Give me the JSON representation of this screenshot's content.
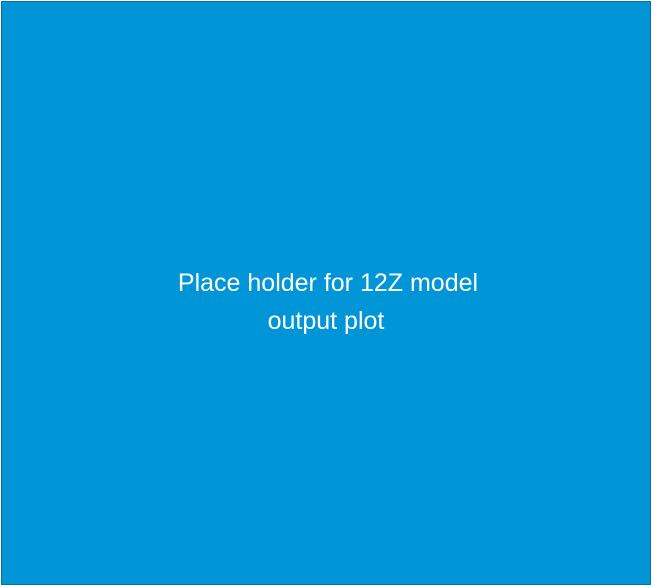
{
  "placeholder": {
    "line1": "Place holder for 12Z model",
    "line2": "output plot"
  },
  "colors": {
    "background": "#0095d7",
    "border": "#0a6f9f",
    "text": "#ffffff"
  }
}
